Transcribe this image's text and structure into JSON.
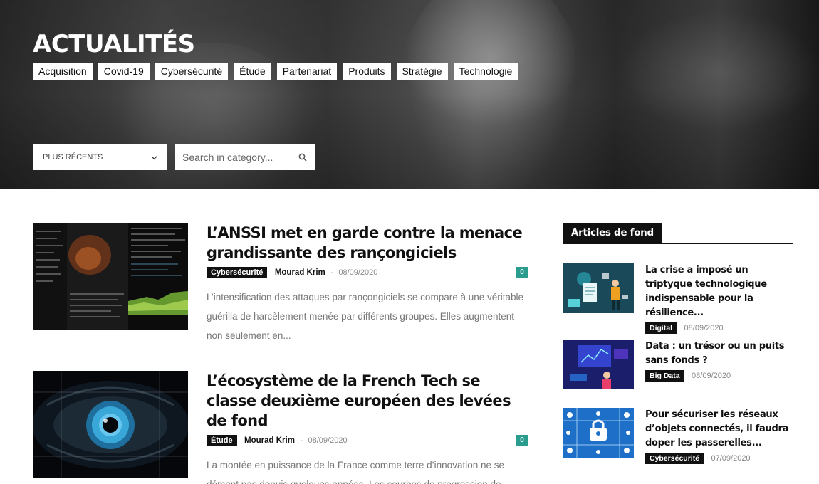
{
  "hero": {
    "title": "ACTUALITÉS",
    "tags": [
      "Acquisition",
      "Covid-19",
      "Cybersécurité",
      "Étude",
      "Partenariat",
      "Produits",
      "Stratégie",
      "Technologie"
    ],
    "sort": {
      "selected": "PLUS RÉCENTS"
    },
    "search": {
      "placeholder": "Search in category..."
    }
  },
  "articles": [
    {
      "title": "L’ANSSI met en garde contre la menace grandissante des rançongiciels",
      "category": "Cybersécurité",
      "author": "Mourad Krim",
      "separator": "-",
      "date": "08/09/2020",
      "comments": "0",
      "excerpt": "L’intensification des attaques par rançongiciels se compare à une véritable guérilla de harcèlement menée par différents groupes. Elles augmentent non seulement en..."
    },
    {
      "title": "L’écosystème de la French Tech se classe deuxième européen des levées de fond",
      "category": "Étude",
      "author": "Mourad Krim",
      "separator": "-",
      "date": "08/09/2020",
      "comments": "0",
      "excerpt": "La montée en puissance de la France comme terre d’innovation ne se dément pas depuis quelques années. Les courbes de progression de..."
    }
  ],
  "sidebar": {
    "heading": "Articles de fond",
    "items": [
      {
        "title": "La crise a imposé un triptyque technologique indispensable pour la résilience...",
        "category": "Digital",
        "date": "08/09/2020"
      },
      {
        "title": "Data : un trésor ou un puits sans fonds ?",
        "category": "Big Data",
        "date": "08/09/2020"
      },
      {
        "title": "Pour sécuriser les réseaux d’objets connectés, il faudra doper les passerelles...",
        "category": "Cybersécurité",
        "date": "07/09/2020"
      }
    ]
  },
  "icons": {
    "sort": "chevron-down-icon",
    "search": "search-icon"
  },
  "colors": {
    "comment_badge": "#2a9d8f",
    "category_badge": "#111111"
  }
}
